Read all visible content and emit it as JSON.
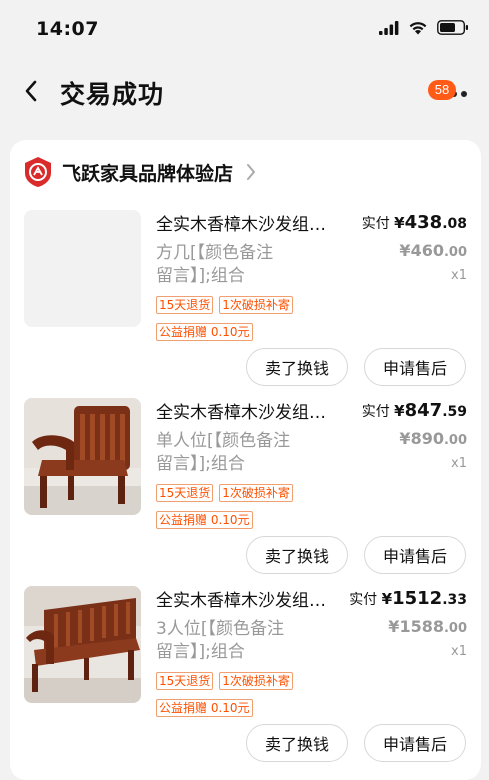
{
  "status_bar": {
    "time": "14:07"
  },
  "header": {
    "title": "交易成功",
    "more_badge": "58"
  },
  "shop": {
    "name": "飞跃家具品牌体验店"
  },
  "items": [
    {
      "title": "全实木香樟木沙发组…",
      "paid_label": "实付",
      "currency": "¥",
      "paid_int": "438",
      "paid_dec": ".08",
      "orig_int": "460",
      "orig_dec": ".00",
      "qty": "x1",
      "spec_line1": "方几[【颜色备注",
      "spec_line2": "留言】];组合",
      "tag_return": "15天退货",
      "tag_damage": "1次破损补寄",
      "tag_charity": "公益捐赠 0.10元",
      "btn_exchange": "卖了换钱",
      "btn_aftersale": "申请售后"
    },
    {
      "title": "全实木香樟木沙发组…",
      "paid_label": "实付",
      "currency": "¥",
      "paid_int": "847",
      "paid_dec": ".59",
      "orig_int": "890",
      "orig_dec": ".00",
      "qty": "x1",
      "spec_line1": "单人位[【颜色备注",
      "spec_line2": "留言】];组合",
      "tag_return": "15天退货",
      "tag_damage": "1次破损补寄",
      "tag_charity": "公益捐赠 0.10元",
      "btn_exchange": "卖了换钱",
      "btn_aftersale": "申请售后"
    },
    {
      "title": "全实木香樟木沙发组…",
      "paid_label": "实付",
      "currency": "¥",
      "paid_int": "1512",
      "paid_dec": ".33",
      "orig_int": "1588",
      "orig_dec": ".00",
      "qty": "x1",
      "spec_line1": "3人位[【颜色备注",
      "spec_line2": "留言】];组合",
      "tag_return": "15天退货",
      "tag_damage": "1次破损补寄",
      "tag_charity": "公益捐赠 0.10元",
      "btn_exchange": "卖了换钱",
      "btn_aftersale": "申请售后"
    }
  ],
  "colors": {
    "accent": "#ff5000",
    "badge": "#ff5a16",
    "shop_logo": "#d92b2b",
    "wood": "#8b3a1e"
  },
  "icons": {
    "back": "chevron-left-icon",
    "more": "more-dots-icon",
    "shop_chevron": "chevron-right-icon",
    "signal": "signal-icon",
    "wifi": "wifi-icon",
    "battery": "battery-icon"
  }
}
